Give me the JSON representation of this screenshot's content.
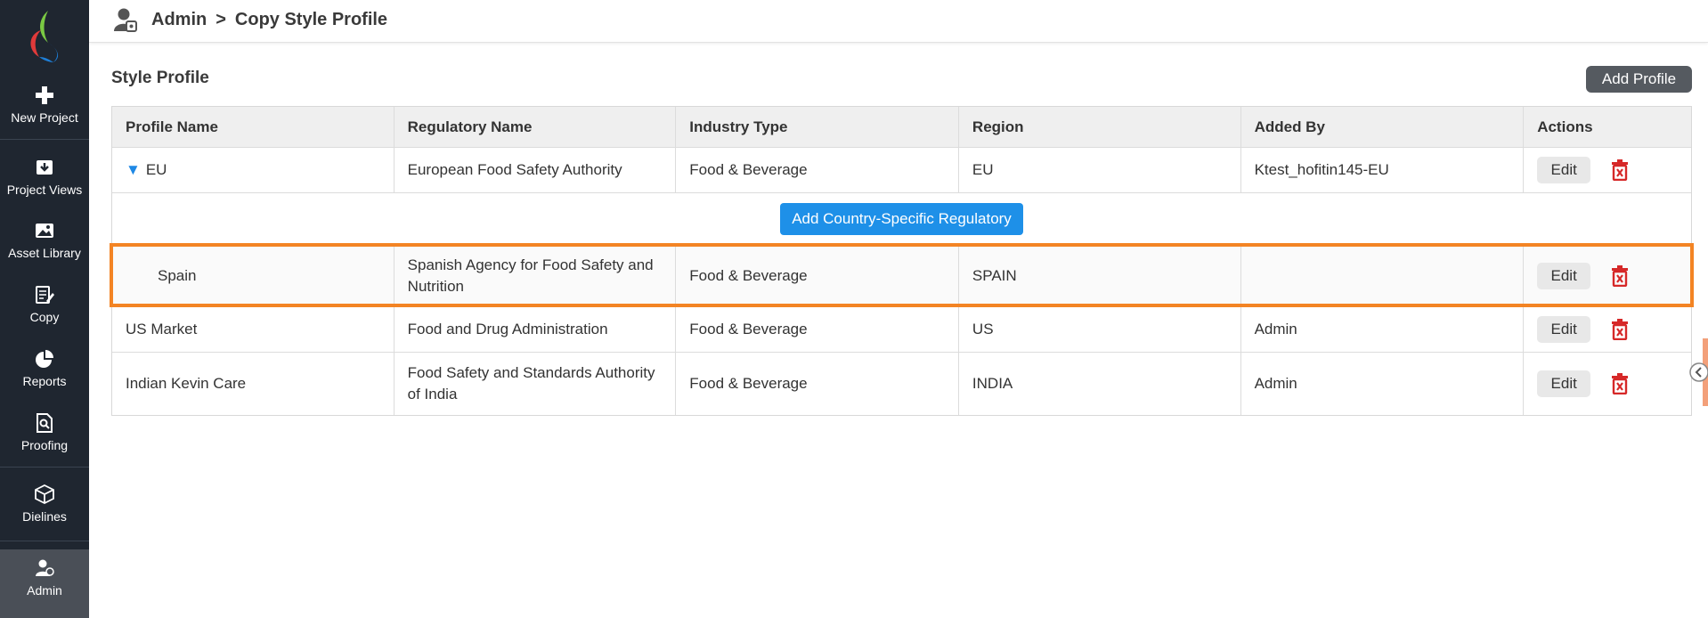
{
  "colors": {
    "sidebar_bg": "#1f2630",
    "primary_blue": "#1e90e8",
    "highlight_orange": "#f38424",
    "delete_red": "#d62828",
    "dark_button": "#555a60"
  },
  "sidebar": {
    "items": [
      {
        "label": "New Project",
        "icon": "plus-icon"
      },
      {
        "label": "Project Views",
        "icon": "download-box-icon"
      },
      {
        "label": "Asset Library",
        "icon": "image-icon"
      },
      {
        "label": "Copy",
        "icon": "edit-document-icon"
      },
      {
        "label": "Reports",
        "icon": "pie-chart-icon"
      },
      {
        "label": "Proofing",
        "icon": "proof-search-icon"
      },
      {
        "label": "Dielines",
        "icon": "box-icon"
      },
      {
        "label": "Admin",
        "icon": "admin-user-icon"
      }
    ]
  },
  "header": {
    "crumb_root": "Admin",
    "crumb_sep": ">",
    "crumb_current": "Copy Style Profile"
  },
  "section": {
    "title": "Style Profile",
    "add_button": "Add Profile"
  },
  "table": {
    "headers": [
      "Profile Name",
      "Regulatory Name",
      "Industry Type",
      "Region",
      "Added By",
      "Actions"
    ],
    "rows": [
      {
        "profile": "EU",
        "regulatory": "European Food Safety Authority",
        "industry": "Food & Beverage",
        "region": "EU",
        "added_by": "Ktest_hofitin145-EU"
      },
      {
        "profile": "Spain",
        "regulatory": "Spanish Agency for Food Safety and Nutrition",
        "industry": "Food & Beverage",
        "region": "SPAIN",
        "added_by": ""
      },
      {
        "profile": "US Market",
        "regulatory": "Food and Drug Administration",
        "industry": "Food & Beverage",
        "region": "US",
        "added_by": "Admin"
      },
      {
        "profile": "Indian Kevin Care",
        "regulatory": "Food Safety and Standards Authority of India",
        "industry": "Food & Beverage",
        "region": "INDIA",
        "added_by": "Admin"
      }
    ],
    "add_country_button": "Add Country-Specific Regulatory",
    "edit_label": "Edit",
    "expand_icon": "▼"
  }
}
